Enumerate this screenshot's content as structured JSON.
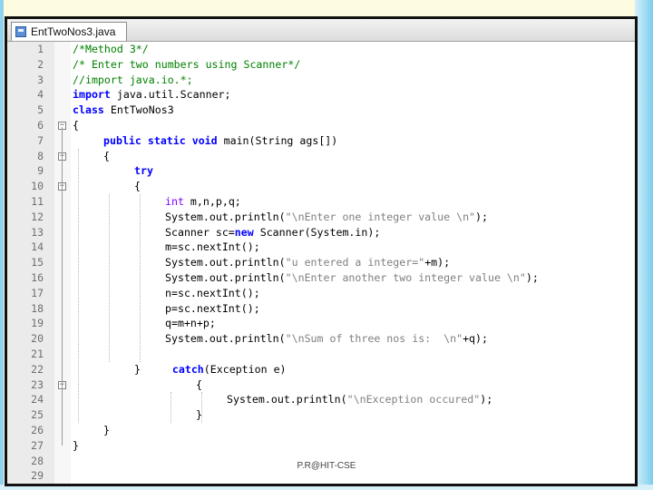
{
  "tab": {
    "label": "EntTwoNos3.java",
    "icon": "java-file-icon"
  },
  "footer": {
    "text": "P.R@HIT-CSE"
  },
  "colors": {
    "keyword": "#0000ff",
    "comment": "#008000",
    "type": "#8000ff",
    "string": "#808080"
  },
  "lines": [
    {
      "n": "1",
      "indent": 0,
      "fold": "",
      "tokens": [
        {
          "t": "/*Method 3*/",
          "c": "cmt"
        }
      ]
    },
    {
      "n": "2",
      "indent": 0,
      "fold": "",
      "tokens": [
        {
          "t": "/* Enter two numbers using Scanner*/",
          "c": "cmt"
        }
      ]
    },
    {
      "n": "3",
      "indent": 0,
      "fold": "",
      "tokens": [
        {
          "t": "//import java.io.*;",
          "c": "cmt"
        }
      ]
    },
    {
      "n": "4",
      "indent": 0,
      "fold": "",
      "tokens": [
        {
          "t": "import",
          "c": "kw"
        },
        {
          "t": " java.util.Scanner;",
          "c": "plain"
        }
      ]
    },
    {
      "n": "5",
      "indent": 0,
      "fold": "",
      "tokens": [
        {
          "t": "class",
          "c": "kw"
        },
        {
          "t": " EntTwoNos3",
          "c": "plain"
        }
      ]
    },
    {
      "n": "6",
      "indent": 0,
      "fold": "-",
      "tokens": [
        {
          "t": "{",
          "c": "plain"
        }
      ]
    },
    {
      "n": "7",
      "indent": 1,
      "fold": "",
      "tokens": [
        {
          "t": "public static void",
          "c": "kw"
        },
        {
          "t": " main(String ags[])",
          "c": "plain"
        }
      ]
    },
    {
      "n": "8",
      "indent": 1,
      "fold": "-",
      "tokens": [
        {
          "t": "{",
          "c": "plain"
        }
      ]
    },
    {
      "n": "9",
      "indent": 2,
      "fold": "",
      "tokens": [
        {
          "t": "try",
          "c": "kw"
        }
      ]
    },
    {
      "n": "10",
      "indent": 2,
      "fold": "-",
      "tokens": [
        {
          "t": "{",
          "c": "plain"
        }
      ]
    },
    {
      "n": "11",
      "indent": 3,
      "fold": "",
      "tokens": [
        {
          "t": "int",
          "c": "typ"
        },
        {
          "t": " m,n,p,q;",
          "c": "plain"
        }
      ]
    },
    {
      "n": "12",
      "indent": 3,
      "fold": "",
      "tokens": [
        {
          "t": "System.out.println(",
          "c": "plain"
        },
        {
          "t": "\"\\nEnter one integer value \\n\"",
          "c": "str"
        },
        {
          "t": ");",
          "c": "plain"
        }
      ]
    },
    {
      "n": "13",
      "indent": 3,
      "fold": "",
      "tokens": [
        {
          "t": "Scanner sc=",
          "c": "plain"
        },
        {
          "t": "new",
          "c": "kw"
        },
        {
          "t": " Scanner(System.in);",
          "c": "plain"
        }
      ]
    },
    {
      "n": "14",
      "indent": 3,
      "fold": "",
      "tokens": [
        {
          "t": "m=sc.nextInt();",
          "c": "plain"
        }
      ]
    },
    {
      "n": "15",
      "indent": 3,
      "fold": "",
      "tokens": [
        {
          "t": "System.out.println(",
          "c": "plain"
        },
        {
          "t": "\"u entered a integer=\"",
          "c": "str"
        },
        {
          "t": "+m);",
          "c": "plain"
        }
      ]
    },
    {
      "n": "16",
      "indent": 3,
      "fold": "",
      "tokens": [
        {
          "t": "System.out.println(",
          "c": "plain"
        },
        {
          "t": "\"\\nEnter another two integer value \\n\"",
          "c": "str"
        },
        {
          "t": ");",
          "c": "plain"
        }
      ]
    },
    {
      "n": "17",
      "indent": 3,
      "fold": "",
      "tokens": [
        {
          "t": "n=sc.nextInt();",
          "c": "plain"
        }
      ]
    },
    {
      "n": "18",
      "indent": 3,
      "fold": "",
      "tokens": [
        {
          "t": "p=sc.nextInt();",
          "c": "plain"
        }
      ]
    },
    {
      "n": "19",
      "indent": 3,
      "fold": "",
      "tokens": [
        {
          "t": "q=m+n+p;",
          "c": "plain"
        }
      ]
    },
    {
      "n": "20",
      "indent": 3,
      "fold": "",
      "tokens": [
        {
          "t": "System.out.println(",
          "c": "plain"
        },
        {
          "t": "\"\\nSum of three nos is:  \\n\"",
          "c": "str"
        },
        {
          "t": "+q);",
          "c": "plain"
        }
      ]
    },
    {
      "n": "21",
      "indent": 3,
      "fold": "",
      "tokens": []
    },
    {
      "n": "22",
      "indent": 2,
      "fold": "",
      "tokens": [
        {
          "t": "}     ",
          "c": "plain"
        },
        {
          "t": "catch",
          "c": "kw"
        },
        {
          "t": "(Exception e)",
          "c": "plain"
        }
      ]
    },
    {
      "n": "23",
      "indent": 4,
      "fold": "-",
      "tokens": [
        {
          "t": "{",
          "c": "plain"
        }
      ]
    },
    {
      "n": "24",
      "indent": 5,
      "fold": "",
      "tokens": [
        {
          "t": "System.out.println(",
          "c": "plain"
        },
        {
          "t": "\"\\nException occured\"",
          "c": "str"
        },
        {
          "t": ");",
          "c": "plain"
        }
      ]
    },
    {
      "n": "25",
      "indent": 4,
      "fold": "",
      "tokens": [
        {
          "t": "}",
          "c": "plain"
        }
      ]
    },
    {
      "n": "26",
      "indent": 1,
      "fold": "",
      "tokens": [
        {
          "t": "}",
          "c": "plain"
        }
      ]
    },
    {
      "n": "27",
      "indent": 0,
      "fold": "",
      "tokens": [
        {
          "t": "}",
          "c": "plain"
        }
      ]
    },
    {
      "n": "28",
      "indent": 0,
      "fold": "",
      "tokens": []
    },
    {
      "n": "29",
      "indent": 0,
      "fold": "",
      "tokens": []
    }
  ]
}
